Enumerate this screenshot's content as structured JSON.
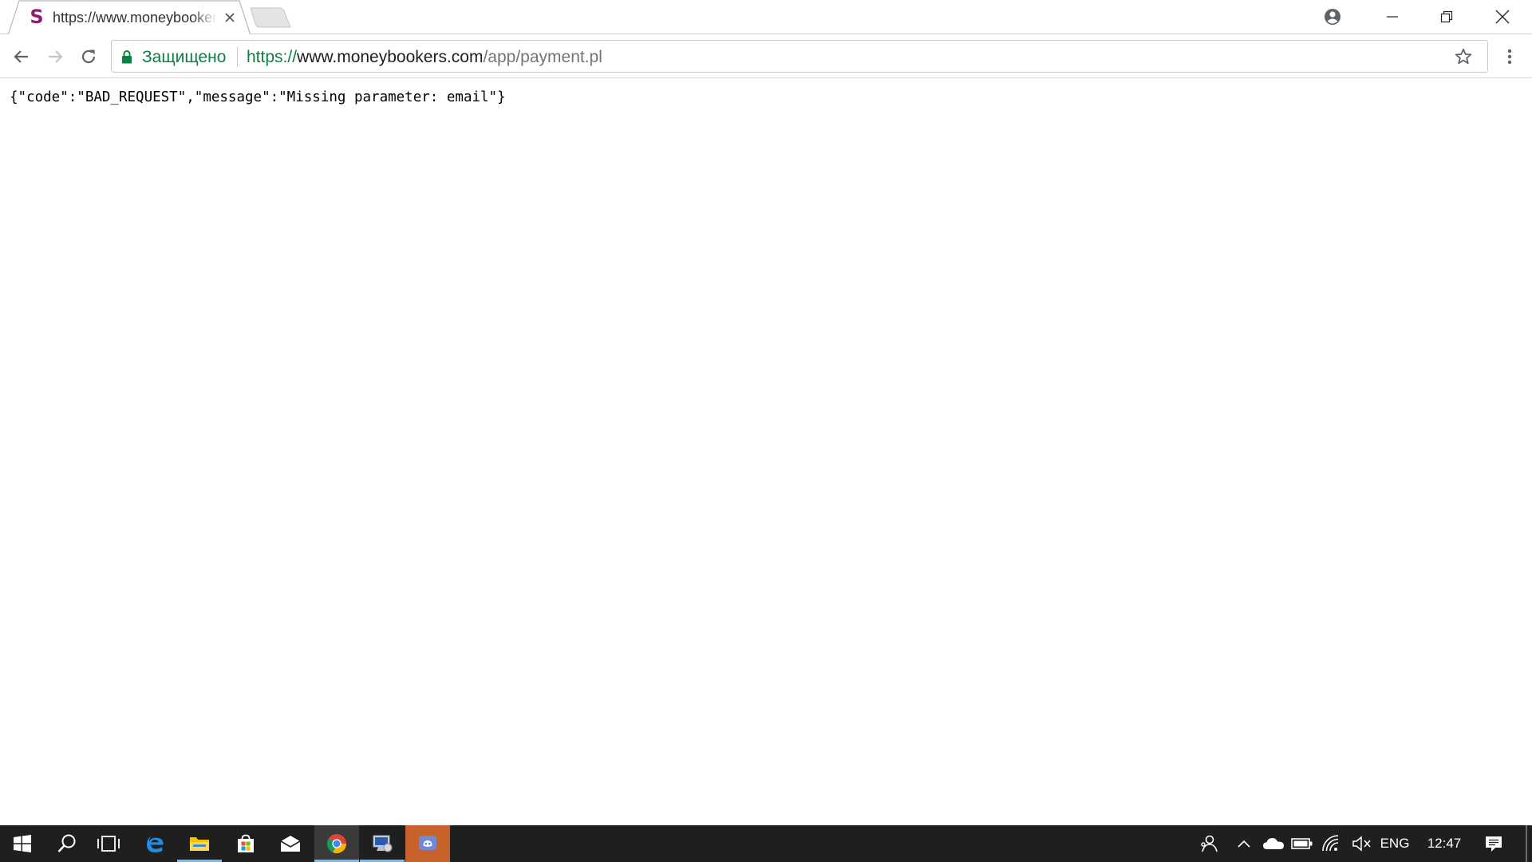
{
  "browser": {
    "tab": {
      "title": "https://www.moneybookers.com/app/payment.pl",
      "favicon_letter": "S",
      "favicon_color": "#8a1d74"
    },
    "omnibox": {
      "security_label": "Защищено",
      "url_scheme": "https://",
      "url_host": "www.moneybookers.com",
      "url_path": "/app/payment.pl",
      "secure_color": "#0b8043"
    }
  },
  "page": {
    "body_text": "{\"code\":\"BAD_REQUEST\",\"message\":\"Missing parameter: email\"}"
  },
  "taskbar": {
    "pinned": [
      {
        "name": "edge-icon"
      },
      {
        "name": "file-explorer-icon"
      },
      {
        "name": "store-icon"
      },
      {
        "name": "mail-icon"
      },
      {
        "name": "chrome-icon",
        "active": true
      },
      {
        "name": "remote-app-icon"
      },
      {
        "name": "discord-icon"
      }
    ],
    "tray": {
      "language": "ENG",
      "time": "12:47"
    },
    "accent_color": "#76b9ed"
  }
}
